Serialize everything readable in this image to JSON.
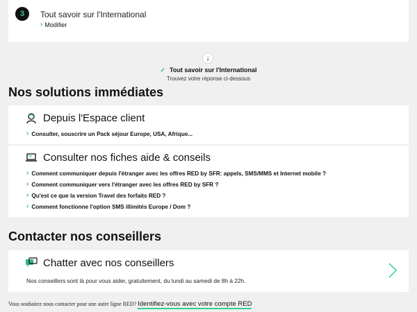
{
  "step": {
    "number": "3",
    "title": "Tout savoir sur l'International",
    "modify_label": "Modifier"
  },
  "answer": {
    "title": "Tout savoir sur l'International",
    "subtitle": "Trouvez votre réponse ci-dessous"
  },
  "solutions": {
    "heading": "Nos solutions immédiates",
    "espace_client": {
      "title": "Depuis l'Espace client",
      "items": [
        "Consulter, souscrire un Pack séjour Europe, USA, Afrique..."
      ]
    },
    "fiches": {
      "title": "Consulter nos fiches aide & conseils",
      "items": [
        "Comment communiquer depuis l'étranger avec les offres RED by SFR: appels, SMS/MMS et Internet mobile ?",
        "Comment communiquer vers l'étranger avec les offres RED by SFR ?",
        "Qu'est ce que la version Travel des forfaits RED ?",
        "Comment fonctionne l'option SMS illimités Europe / Dom ?"
      ]
    }
  },
  "contact": {
    "heading": "Contacter nos conseillers",
    "chat": {
      "title": "Chatter avec nos conseillers",
      "description": "Nos conseillers sont là pour vous aider, gratuitement, du lundi au samedi de 8h à 22h."
    }
  },
  "footer": {
    "text": "Vous souhaitez nous contacter pour une autre ligne RED?",
    "link": "Identifiez-vous avec votre compte RED"
  },
  "icons": {
    "chevron": "chevron-right-icon",
    "check": "check-icon",
    "arrow": "arrow-down-icon",
    "user": "user-icon",
    "laptop": "laptop-icon",
    "chat": "chat-icon"
  },
  "colors": {
    "accent": "#2fd18f",
    "background": "#f0f0f0",
    "card": "#ffffff"
  }
}
